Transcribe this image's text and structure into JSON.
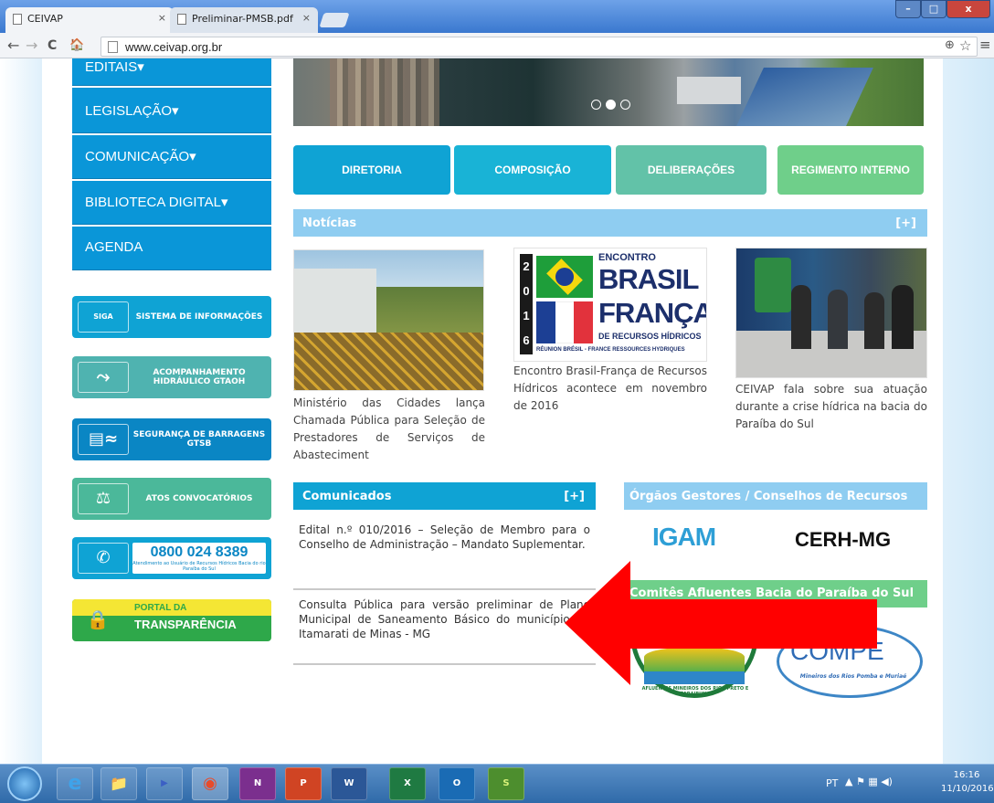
{
  "browser": {
    "tabs": [
      {
        "title": "CEIVAP",
        "close": "×"
      },
      {
        "title": "Preliminar-PMSB.pdf",
        "close": "×"
      }
    ],
    "url": "www.ceivap.org.br",
    "back": "←",
    "forward": "→",
    "reload": "C",
    "home": "🏠",
    "zoom_icon": "⊕",
    "star_icon": "☆",
    "menu_icon": "≡",
    "win_min": "–",
    "win_max": "□",
    "win_close": "x"
  },
  "sidebar": {
    "menu": [
      "EDITAIS",
      "LEGISLAÇÃO",
      "COMUNICAÇÃO",
      "BIBLIOTECA DIGITAL",
      "AGENDA"
    ],
    "caret": "▾",
    "buttons": [
      {
        "label": "SISTEMA DE INFORMAÇÕES",
        "icon_text": "SIGA CEIVAP",
        "color": "#0fa3d4"
      },
      {
        "label": "ACOMPANHAMENTO HIDRÁULICO GTAOH",
        "icon_text": "⤳",
        "color": "#4fb3b0"
      },
      {
        "label": "SEGURANÇA DE BARRAGENS GTSB",
        "icon_text": "▤≈",
        "color": "#0a86c4"
      },
      {
        "label": "ATOS CONVOCATÓRIOS",
        "icon_text": "⚖",
        "color": "#4bb89a"
      },
      {
        "label": "0800 024 8389",
        "sub": "Atendimento ao Usuário de Recursos Hídricos Bacia do rio Paraíba do Sul",
        "icon_text": "✆",
        "color": "#0fa3d4"
      },
      {
        "label_top": "PORTAL DA",
        "label_bottom": "TRANSPARÊNCIA",
        "icon_text": "🔒",
        "color_top": "#f4e634",
        "color_bottom": "#2ea84a"
      }
    ]
  },
  "slider": {
    "active_dot": 1,
    "dots": 3
  },
  "top_buttons": [
    {
      "label": "DIRETORIA",
      "color": "#0fa3d4"
    },
    {
      "label": "COMPOSIÇÃO",
      "color": "#19b3d6"
    },
    {
      "label": "DELIBERAÇÕES",
      "color": "#62c2a8"
    },
    {
      "label": "REGIMENTO INTERNO",
      "color": "#6fcf8a"
    }
  ],
  "news": {
    "title": "Notícias",
    "more": "[+]",
    "items": [
      {
        "caption": "Ministério das Cidades lança Chamada Pública para Seleção de Prestadores de Serviços de Abasteciment"
      },
      {
        "caption": "Encontro Brasil-França de Recursos Hídricos acontece em novembro de 2016",
        "banner": {
          "year": [
            "2",
            "0",
            "1",
            "6"
          ],
          "line1": "ENCONTRO",
          "line2": "BRASIL",
          "line3": "FRANÇA",
          "line4": "DE RECURSOS HÍDRICOS",
          "line5": "RÉUNION BRÉSIL - FRANCE RESSOURCES HYDRIQUES"
        }
      },
      {
        "caption": "CEIVAP fala sobre sua atuação durante a crise hídrica na bacia do Paraíba do Sul"
      }
    ]
  },
  "comunicados": {
    "title": "Comunicados",
    "more": "[+]",
    "items": [
      "Edital n.º 010/2016 – Seleção de Membro para o Conselho de Administração – Mandato Suplementar.",
      "Consulta Pública para versão preliminar de Plano Municipal de Saneamento Básico do município de Itamarati de Minas - MG"
    ]
  },
  "orgaos": {
    "title": "Órgãos Gestores / Conselhos de Recursos",
    "igam": "IGAM",
    "cerh": "CERH-MG",
    "comites_title": "Comitês Afluentes Bacia do Paraíba do Sul",
    "compe": "COMPE",
    "compe_ring": "Mineiros dos Rios Pomba e Muriaé",
    "preto_ring": "AFLUENTES MINEIROS DOS RIOS PRETO E PARAIBUNA"
  },
  "annotation": {
    "arrow_color": "#ff0000"
  },
  "taskbar": {
    "apps": [
      "e",
      "📁",
      "▶",
      "◉",
      "N",
      "P",
      "W",
      "X",
      "O",
      "S"
    ],
    "lang": "PT",
    "time": "16:16",
    "date": "11/10/2016"
  }
}
